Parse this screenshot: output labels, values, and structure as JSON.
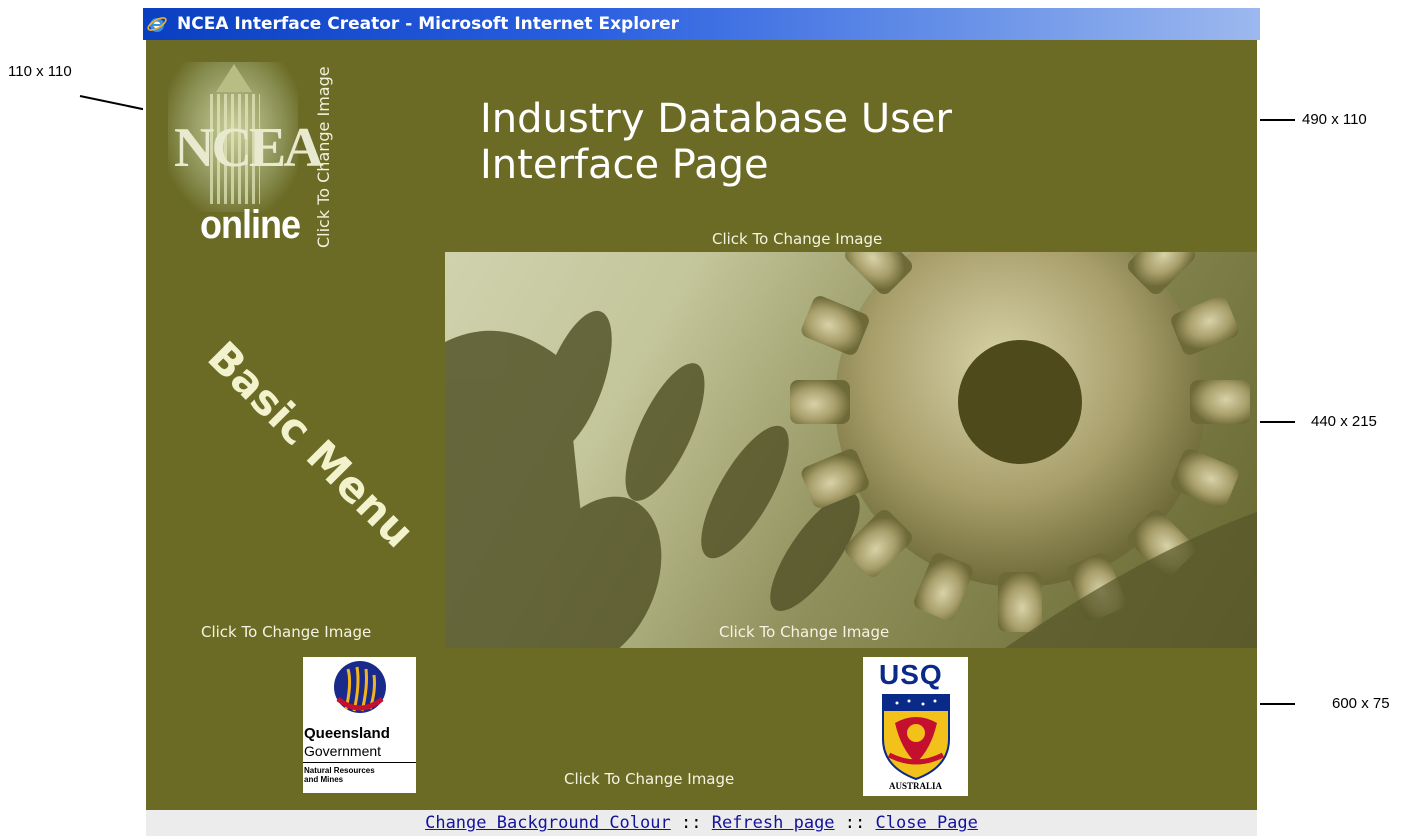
{
  "window": {
    "title": "NCEA Interface Creator - Microsoft Internet Explorer"
  },
  "annotations": {
    "logo_size": "110 x 110",
    "header_size": "490 x 110",
    "main_image_size": "440 x 215",
    "footer_logos_size": "600 x 75"
  },
  "page": {
    "header_title_line1": "Industry Database User",
    "header_title_line2": "Interface Page",
    "menu_label": "Basic Menu",
    "logo_text": "NCEA",
    "logo_subtext": "online",
    "captions": {
      "logo": "Click To Change Image",
      "main_image_top": "Click To Change Image",
      "menu": "Click To Change Image",
      "main_image_bottom": "Click To Change Image",
      "footer_logos": "Click To Change Image"
    },
    "qld_logo": {
      "line1": "Queensland",
      "line2": "Government",
      "line3": "Natural Resources",
      "line4": "and Mines"
    },
    "usq_logo": {
      "title": "USQ",
      "country": "AUSTRALIA"
    }
  },
  "footer": {
    "change_bg": "Change Background Colour",
    "separator1": "::",
    "refresh": "Refresh page",
    "separator2": "::",
    "close": "Close Page"
  },
  "colors": {
    "page_background": "#6b6b25",
    "titlebar": "#0b3fc2",
    "link": "#13139c"
  }
}
